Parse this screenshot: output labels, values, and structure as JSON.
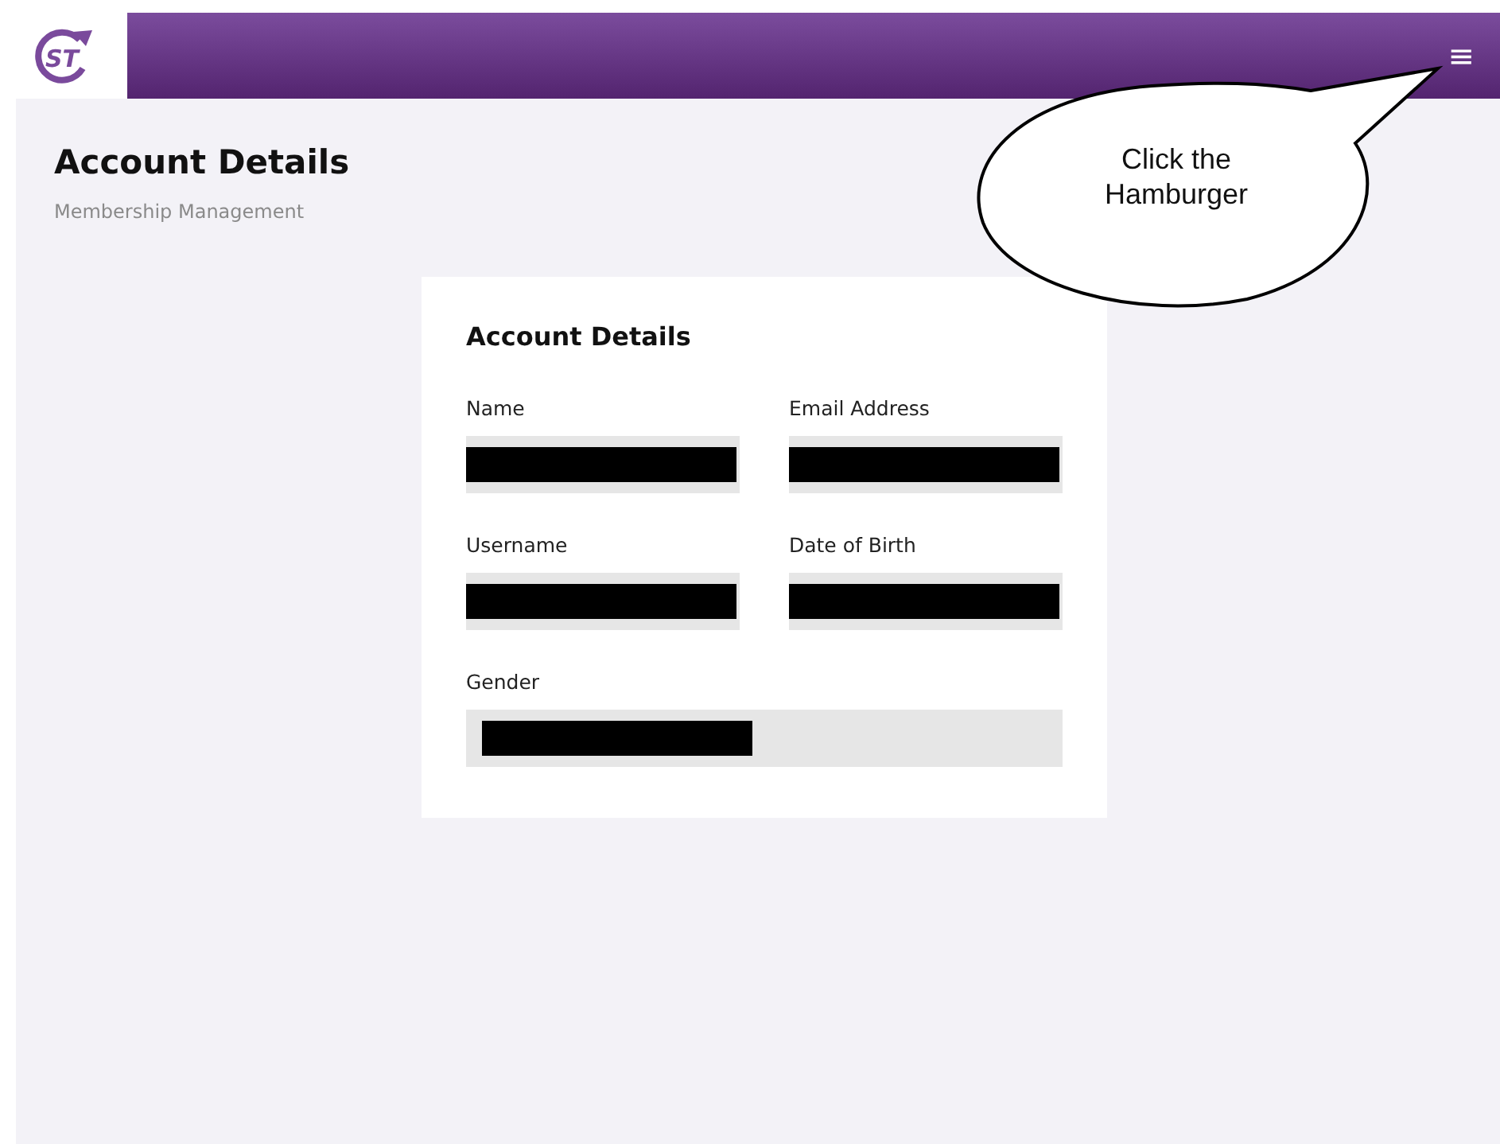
{
  "header": {
    "logo": {
      "text": "ST"
    },
    "menu_icon": "≡"
  },
  "page": {
    "title": "Account Details",
    "subtitle": "Membership Management"
  },
  "card": {
    "title": "Account Details",
    "rows": [
      [
        {
          "label": "Name",
          "redacted": true
        },
        {
          "label": "Email Address",
          "redacted": true
        }
      ],
      [
        {
          "label": "Username",
          "redacted": true
        },
        {
          "label": "Date of Birth",
          "redacted": true
        }
      ],
      [
        {
          "label": "Gender",
          "redacted": true
        }
      ]
    ]
  },
  "callout": {
    "text": "Click the Hamburger"
  }
}
